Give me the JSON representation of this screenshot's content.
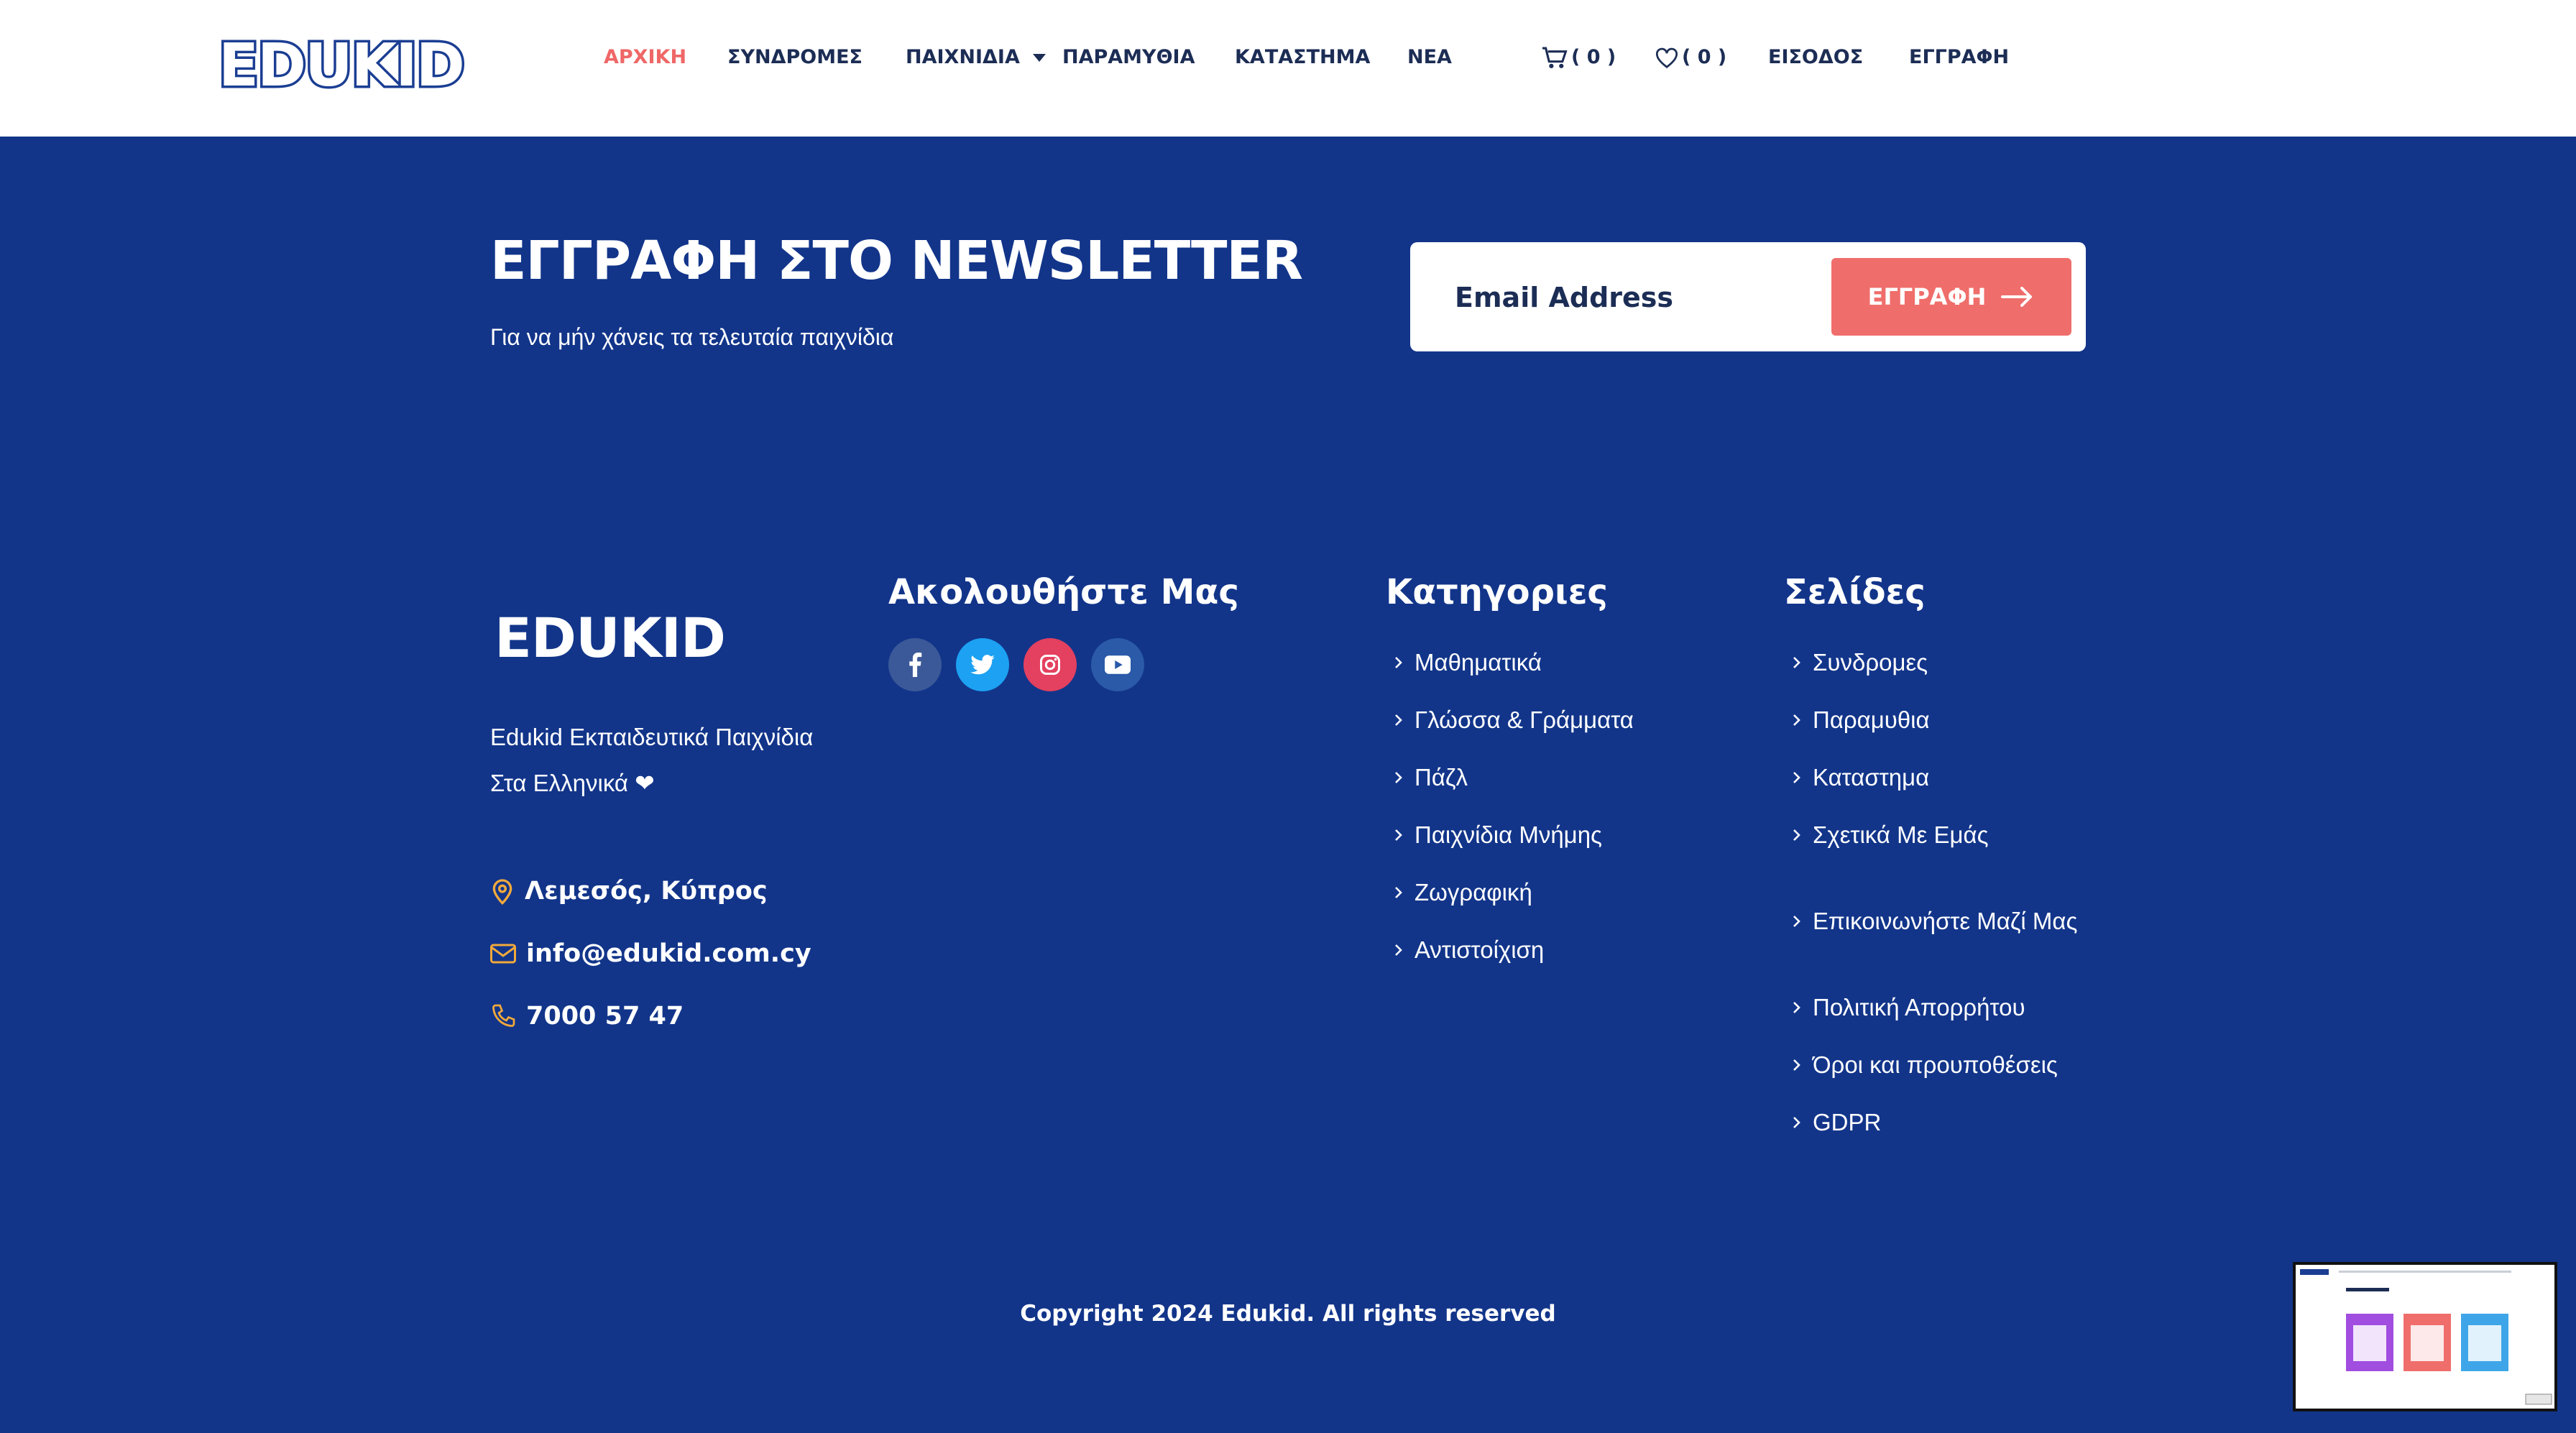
{
  "header": {
    "logo": "EDUKID",
    "nav": [
      {
        "label": "ΑΡΧΙΚΗ",
        "active": true
      },
      {
        "label": "ΣΥΝΔΡΟΜΕΣ"
      },
      {
        "label": "ΠΑΙΧΝΙΔΙΑ",
        "dropdown": true
      },
      {
        "label": "ΠΑΡΑΜΥΘΙΑ"
      },
      {
        "label": "ΚΑΤΑΣΤΗΜΑ"
      },
      {
        "label": "ΝΕΑ"
      }
    ],
    "cart_count": "( 0 )",
    "wishlist_count": "( 0 )",
    "login": "ΕΙΣΟΔΟΣ",
    "register": "ΕΓΓΡΑΦΗ"
  },
  "newsletter": {
    "title": "ΕΓΓΡΑΦΗ ΣΤΟ NEWSLETTER",
    "subtitle": "Για να μήν χάνεις τα τελευταία παιχνίδια",
    "email_placeholder": "Email Address",
    "button_label": "ΕΓΓΡΑΦΗ"
  },
  "footer": {
    "logo": "EDUKID",
    "description_line1": "Edukid Εκπαιδευτικά Παιχνίδια",
    "description_line2": "Στα Ελληνικά ❤",
    "location": "Λεμεσός, Κύπρος",
    "email": "info@edukid.com.cy",
    "phone": "7000 57 47",
    "follow_title": "Ακολουθήστε Μας",
    "social": [
      "facebook-icon",
      "twitter-icon",
      "instagram-icon",
      "youtube-icon"
    ],
    "categories_title": "Κατηγοριες",
    "categories": [
      "Μαθηματικά",
      "Γλώσσα & Γράμματα",
      "Πάζλ",
      "Παιχνίδια Μνήμης",
      "Ζωγραφική",
      "Αντιστοίχιση"
    ],
    "pages_title": "Σελίδες",
    "pages": [
      "Συνδρομες",
      "Παραμυθια",
      "Καταστημα",
      "Σχετικά Με Εμάς",
      "Επικοινωνήστε Μαζί Μας",
      "Πολιτική Απορρήτου",
      "Όροι και προυποθέσεις",
      "GDPR"
    ],
    "copyright": "Copyright 2024 Edukid. All rights reserved"
  },
  "colors": {
    "background": "#12358a",
    "accent": "#ef6e6b",
    "nav_text": "#1c2d55",
    "icon_gold": "#f2a93b"
  }
}
